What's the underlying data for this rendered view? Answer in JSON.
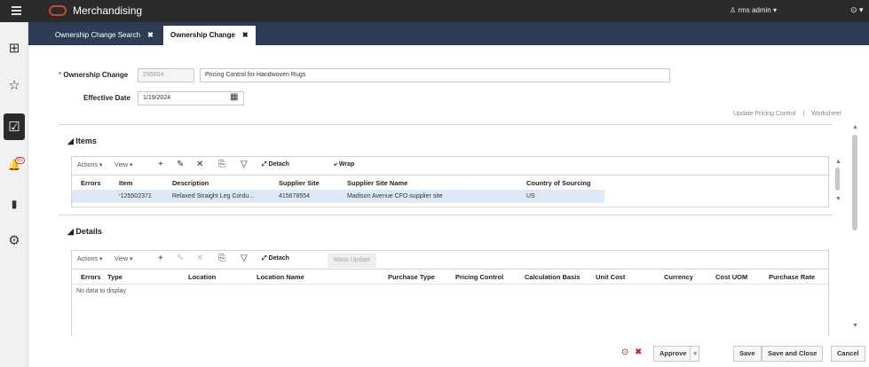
{
  "app": {
    "title": "Merchandising",
    "user": "rms admin",
    "user_caret": "▾",
    "help": "⊙ ▾"
  },
  "icons": {
    "menu": "hamburger-icon",
    "brand": "oracle-logo"
  },
  "sidebar": {
    "items": [
      {
        "name": "dashboard",
        "glyph": "⊞"
      },
      {
        "name": "favorites",
        "glyph": "☆"
      },
      {
        "name": "tasks",
        "glyph": "☑"
      },
      {
        "name": "notifications",
        "glyph": "🔔",
        "badge": "85"
      },
      {
        "name": "reports",
        "glyph": "▮"
      },
      {
        "name": "settings",
        "glyph": "⚙"
      }
    ]
  },
  "tabs": [
    {
      "label": "Ownership Change Search",
      "close": "✖"
    },
    {
      "label": "Ownership Change",
      "close": "✖"
    }
  ],
  "form": {
    "required_mark": "*",
    "ownership_change_label": "Ownership Change",
    "ownership_change_id": "295004",
    "description": "Pricing Control for Handwoven Rugs",
    "effective_date_label": "Effective Date",
    "effective_date": "1/19/2024"
  },
  "links": {
    "update_pricing_control": "Update Pricing Control",
    "separator": "|",
    "worksheet": "Worksheet"
  },
  "items_section": {
    "title": "◢ Items",
    "toolbar": {
      "actions": "Actions ▾",
      "view": "View ▾",
      "add": "+",
      "edit": "✎",
      "delete": "✕",
      "freeze": "⎘",
      "filter": "▽",
      "detach": "⤢ Detach",
      "wrap": "⤶ Wrap"
    },
    "columns": [
      "Errors",
      "Item",
      "Description",
      "Supplier Site",
      "Supplier Site Name",
      "Country of Sourcing"
    ],
    "rows": [
      {
        "errors": "",
        "item_flag": "*",
        "item": "125502371",
        "description": "Relaxed Straight Leg Cordu...",
        "supplier_site": "415678554",
        "supplier_site_name": "Madison Avenue CFO supplier site",
        "country": "US"
      }
    ]
  },
  "details_section": {
    "title": "◢ Details",
    "toolbar": {
      "actions": "Actions ▾",
      "view": "View ▾",
      "add": "+",
      "edit": "✎",
      "delete": "✕",
      "freeze": "⎘",
      "filter": "▽",
      "detach": "⤢ Detach",
      "mass_update": "Mass Update"
    },
    "columns": [
      "Errors",
      "Type",
      "Location",
      "Location Name",
      "Purchase Type",
      "Pricing Control",
      "Calculation Basis",
      "Unit Cost",
      "Currency",
      "Cost UOM",
      "Purchase Rate"
    ],
    "no_data": "No data to display"
  },
  "footer": {
    "help_icon": "⊙",
    "reject_icon": "✖",
    "approve": "Approve",
    "approve_caret": "▾",
    "save": "Save",
    "save_and_close": "Save and Close",
    "cancel": "Cancel"
  },
  "colors": {
    "topbar": "#2b2b2b",
    "tabbar": "#2e3d55",
    "brand": "#c74634",
    "selected_row": "#dce9f6",
    "reject": "#cc2020"
  }
}
